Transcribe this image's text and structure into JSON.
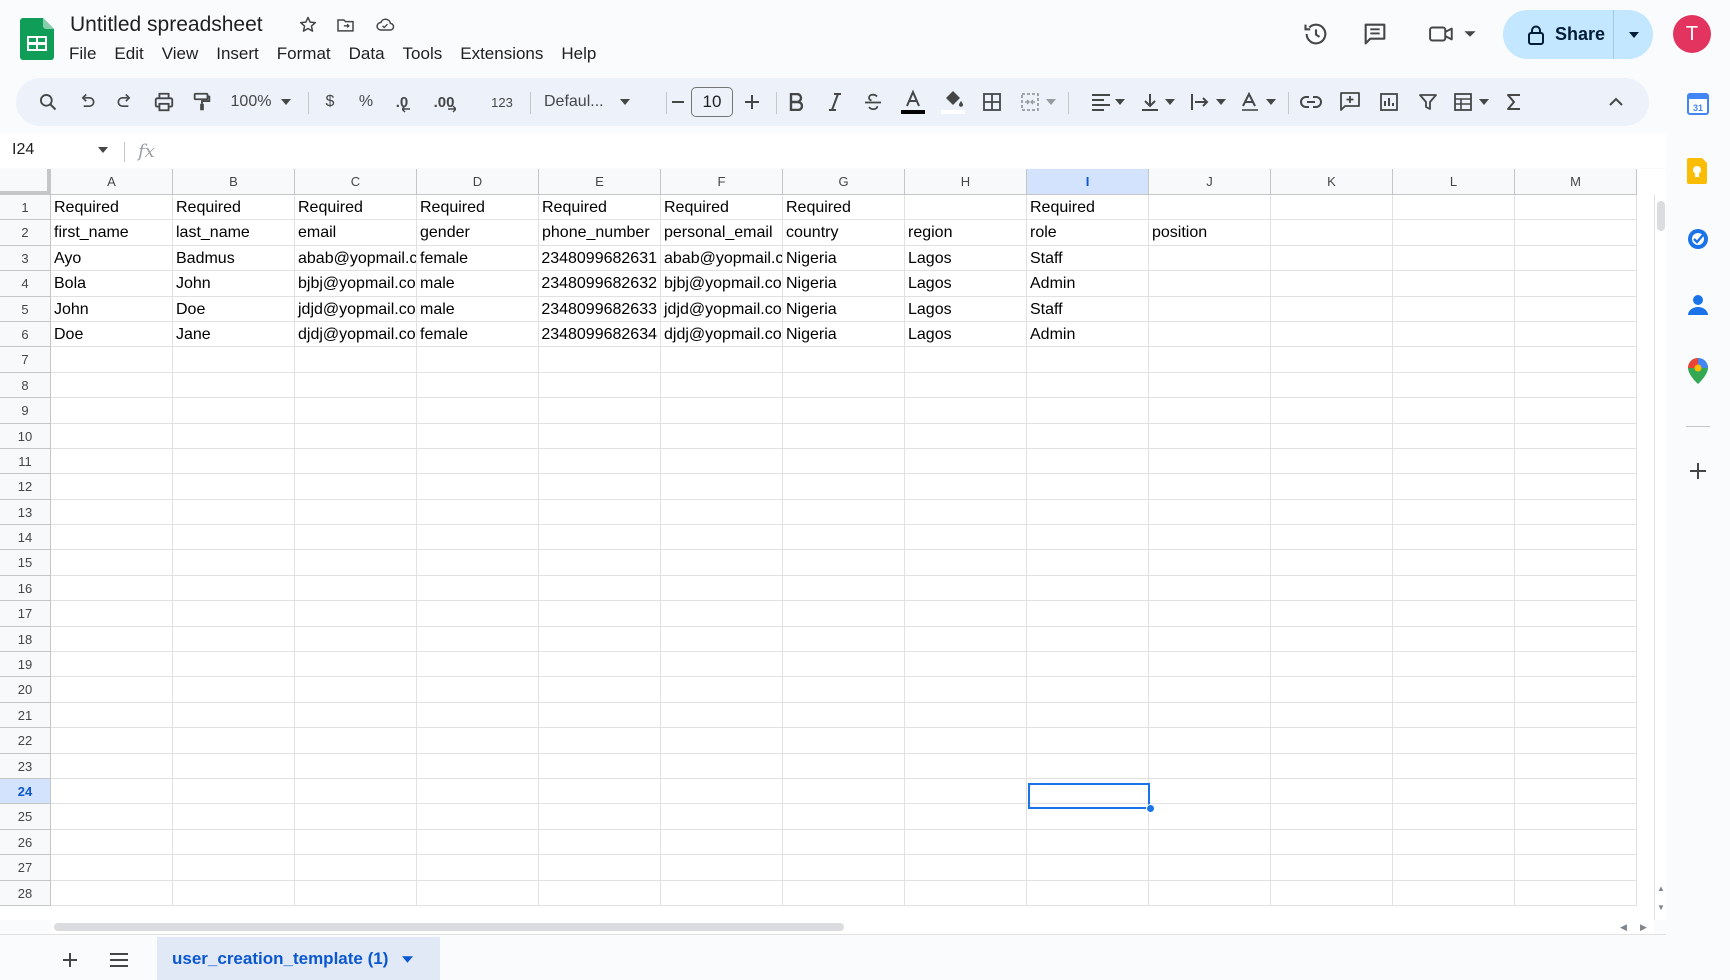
{
  "app": {
    "title": "Untitled spreadsheet",
    "menu": [
      "File",
      "Edit",
      "View",
      "Insert",
      "Format",
      "Data",
      "Tools",
      "Extensions",
      "Help"
    ],
    "share_label": "Share",
    "avatar_initial": "T",
    "accent_color": "#0b57d0",
    "share_bg": "#c2e7ff"
  },
  "toolbar": {
    "zoom": "100%",
    "currency": "$",
    "percent": "%",
    "decrease_decimal": ".0",
    "increase_decimal": ".00",
    "format_number": "123",
    "font": "Defaul...",
    "font_size": "10"
  },
  "formula_bar": {
    "cell_ref": "I24",
    "fx": "fx",
    "content": ""
  },
  "grid": {
    "columns": [
      "A",
      "B",
      "C",
      "D",
      "E",
      "F",
      "G",
      "H",
      "I",
      "J",
      "K",
      "L",
      "M"
    ],
    "selected_column": "I",
    "selected_row": 24,
    "row_count": 28,
    "rows": [
      [
        "Required",
        "Required",
        "Required",
        "Required",
        "Required",
        "Required",
        "Required",
        "",
        "Required",
        "",
        "",
        "",
        ""
      ],
      [
        "first_name",
        "last_name",
        "email",
        "gender",
        "phone_number",
        "personal_email",
        "country",
        "region",
        "role",
        "position",
        "",
        "",
        ""
      ],
      [
        "Ayo",
        "Badmus",
        "abab@yopmail.c",
        "female",
        "2348099682631",
        "abab@yopmail.c",
        "Nigeria",
        "Lagos",
        "Staff",
        "",
        "",
        "",
        ""
      ],
      [
        "Bola",
        "John",
        "bjbj@yopmail.co",
        "male",
        "2348099682632",
        "bjbj@yopmail.co",
        "Nigeria",
        "Lagos",
        "Admin",
        "",
        "",
        "",
        ""
      ],
      [
        "John",
        "Doe",
        "jdjd@yopmail.co",
        "male",
        "2348099682633",
        "jdjd@yopmail.co",
        "Nigeria",
        "Lagos",
        "Staff",
        "",
        "",
        "",
        ""
      ],
      [
        "Doe",
        "Jane",
        "djdj@yopmail.co",
        "female",
        "2348099682634",
        "djdj@yopmail.co",
        "Nigeria",
        "Lagos",
        "Admin",
        "",
        "",
        "",
        ""
      ]
    ]
  },
  "sheets": {
    "active": "user_creation_template (1)"
  },
  "side_panel": {
    "icons": [
      "calendar-icon",
      "keep-icon",
      "tasks-icon",
      "contacts-icon",
      "maps-icon",
      "add-icon"
    ]
  }
}
